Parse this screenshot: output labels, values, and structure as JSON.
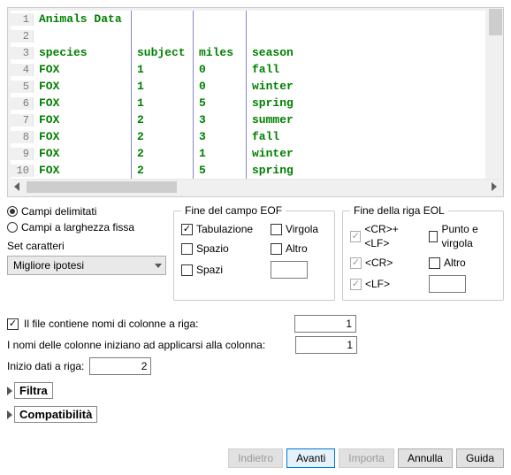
{
  "preview": {
    "rows": [
      {
        "n": "1",
        "c0": "Animals Data",
        "c1": "",
        "c2": "",
        "c3": ""
      },
      {
        "n": "2",
        "c0": "",
        "c1": "",
        "c2": "",
        "c3": ""
      },
      {
        "n": "3",
        "c0": "species",
        "c1": "subject",
        "c2": "miles",
        "c3": "season"
      },
      {
        "n": "4",
        "c0": "FOX",
        "c1": "1",
        "c2": "0",
        "c3": "fall"
      },
      {
        "n": "5",
        "c0": "FOX",
        "c1": "1",
        "c2": "0",
        "c3": "winter"
      },
      {
        "n": "6",
        "c0": "FOX",
        "c1": "1",
        "c2": "5",
        "c3": "spring"
      },
      {
        "n": "7",
        "c0": "FOX",
        "c1": "2",
        "c2": "3",
        "c3": "summer"
      },
      {
        "n": "8",
        "c0": "FOX",
        "c1": "2",
        "c2": "3",
        "c3": "fall"
      },
      {
        "n": "9",
        "c0": "FOX",
        "c1": "2",
        "c2": "1",
        "c3": "winter"
      },
      {
        "n": "10",
        "c0": "FOX",
        "c1": "2",
        "c2": "5",
        "c3": "spring"
      }
    ]
  },
  "radios": {
    "delimited": "Campi delimitati",
    "fixed": "Campi a larghezza fissa"
  },
  "charset": {
    "label": "Set caratteri",
    "value": "Migliore ipotesi"
  },
  "eof": {
    "legend": "Fine del campo EOF",
    "tab": "Tabulazione",
    "comma": "Virgola",
    "space": "Spazio",
    "other": "Altro",
    "spaces": "Spazi"
  },
  "eol": {
    "legend": "Fine della riga EOL",
    "crlf": "<CR>+<LF>",
    "semicolon": "Punto e virgola",
    "cr": "<CR>",
    "other": "Altro",
    "lf": "<LF>"
  },
  "form": {
    "hasHeader": "Il file contiene nomi di colonne a riga:",
    "hasHeaderValue": "1",
    "colStart": "I nomi delle colonne iniziano ad applicarsi alla colonna:",
    "colStartValue": "1",
    "dataStart": "Inizio dati a riga:",
    "dataStartValue": "2"
  },
  "expanders": {
    "filter": "Filtra",
    "compat": "Compatibilità"
  },
  "buttons": {
    "back": "Indietro",
    "next": "Avanti",
    "import": "Importa",
    "cancel": "Annulla",
    "help": "Guida"
  }
}
